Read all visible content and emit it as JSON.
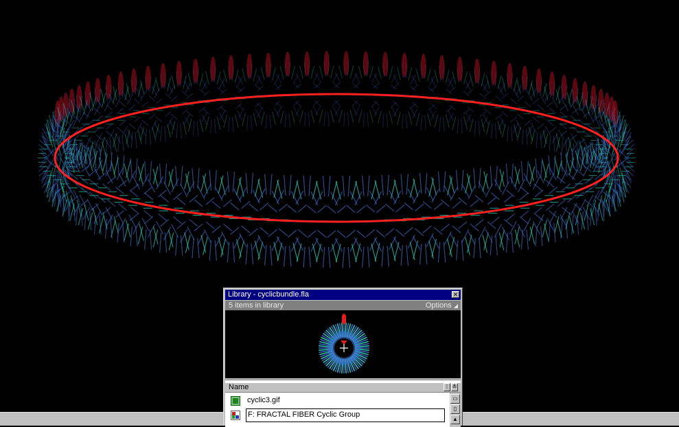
{
  "library": {
    "title": "Library - cyclicbundle.fla",
    "item_count": "5 items in library",
    "options": "Options",
    "column_name": "Name",
    "items": [
      {
        "label": "cyclic3.gif",
        "icon": "bitmap-icon"
      },
      {
        "label": "F: FRACTAL FIBER Cyclic Group",
        "icon": "graphic-symbol-icon"
      }
    ]
  },
  "colors": {
    "stage": "#000000",
    "titlebar": "#000080",
    "torus_ring": "#ff2020",
    "fiber_blue": "#3c6cc8",
    "fiber_cyan": "#30d0c0",
    "fiber_red": "#a01020"
  }
}
